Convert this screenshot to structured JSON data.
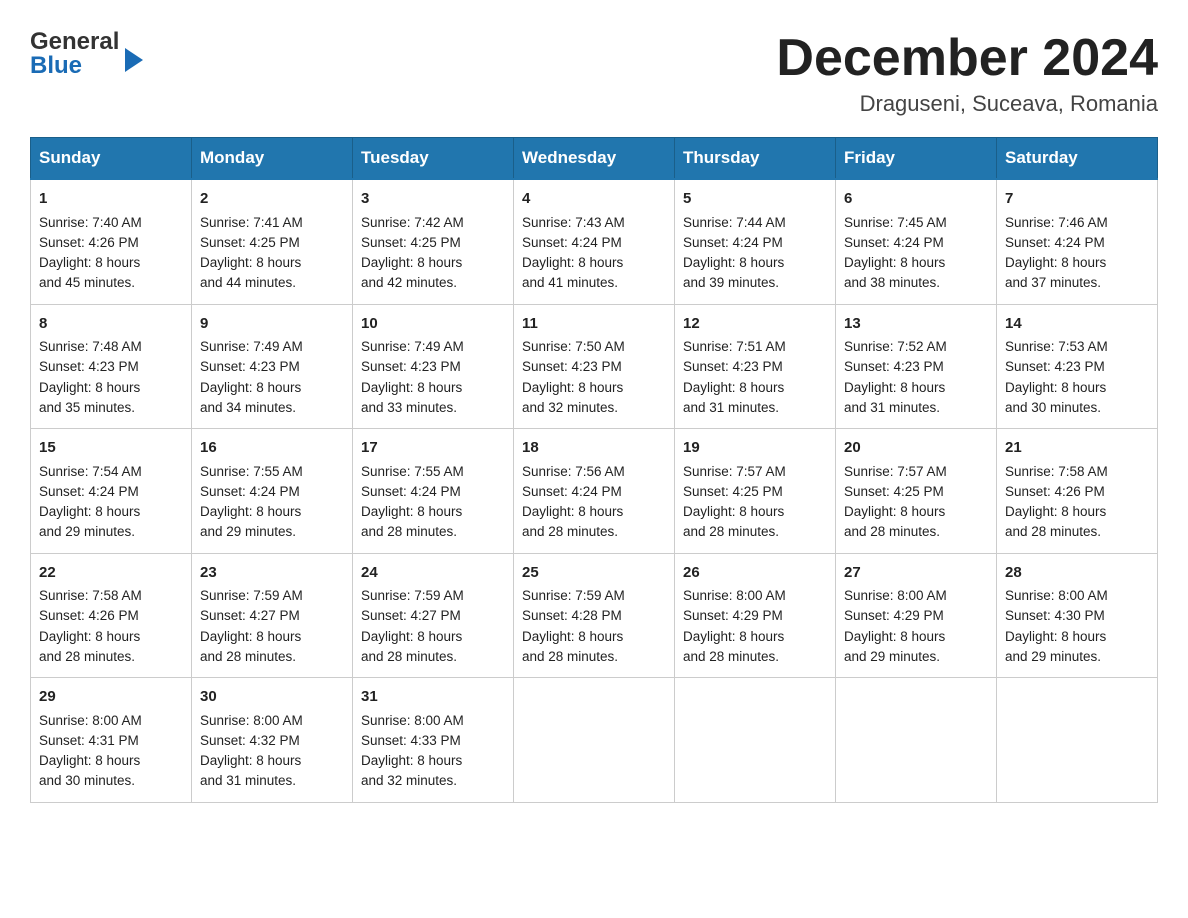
{
  "header": {
    "logo_general": "General",
    "logo_blue": "Blue",
    "month_title": "December 2024",
    "location": "Draguseni, Suceava, Romania"
  },
  "days_of_week": [
    "Sunday",
    "Monday",
    "Tuesday",
    "Wednesday",
    "Thursday",
    "Friday",
    "Saturday"
  ],
  "weeks": [
    [
      {
        "day": "1",
        "sunrise": "Sunrise: 7:40 AM",
        "sunset": "Sunset: 4:26 PM",
        "daylight": "Daylight: 8 hours",
        "daylight2": "and 45 minutes."
      },
      {
        "day": "2",
        "sunrise": "Sunrise: 7:41 AM",
        "sunset": "Sunset: 4:25 PM",
        "daylight": "Daylight: 8 hours",
        "daylight2": "and 44 minutes."
      },
      {
        "day": "3",
        "sunrise": "Sunrise: 7:42 AM",
        "sunset": "Sunset: 4:25 PM",
        "daylight": "Daylight: 8 hours",
        "daylight2": "and 42 minutes."
      },
      {
        "day": "4",
        "sunrise": "Sunrise: 7:43 AM",
        "sunset": "Sunset: 4:24 PM",
        "daylight": "Daylight: 8 hours",
        "daylight2": "and 41 minutes."
      },
      {
        "day": "5",
        "sunrise": "Sunrise: 7:44 AM",
        "sunset": "Sunset: 4:24 PM",
        "daylight": "Daylight: 8 hours",
        "daylight2": "and 39 minutes."
      },
      {
        "day": "6",
        "sunrise": "Sunrise: 7:45 AM",
        "sunset": "Sunset: 4:24 PM",
        "daylight": "Daylight: 8 hours",
        "daylight2": "and 38 minutes."
      },
      {
        "day": "7",
        "sunrise": "Sunrise: 7:46 AM",
        "sunset": "Sunset: 4:24 PM",
        "daylight": "Daylight: 8 hours",
        "daylight2": "and 37 minutes."
      }
    ],
    [
      {
        "day": "8",
        "sunrise": "Sunrise: 7:48 AM",
        "sunset": "Sunset: 4:23 PM",
        "daylight": "Daylight: 8 hours",
        "daylight2": "and 35 minutes."
      },
      {
        "day": "9",
        "sunrise": "Sunrise: 7:49 AM",
        "sunset": "Sunset: 4:23 PM",
        "daylight": "Daylight: 8 hours",
        "daylight2": "and 34 minutes."
      },
      {
        "day": "10",
        "sunrise": "Sunrise: 7:49 AM",
        "sunset": "Sunset: 4:23 PM",
        "daylight": "Daylight: 8 hours",
        "daylight2": "and 33 minutes."
      },
      {
        "day": "11",
        "sunrise": "Sunrise: 7:50 AM",
        "sunset": "Sunset: 4:23 PM",
        "daylight": "Daylight: 8 hours",
        "daylight2": "and 32 minutes."
      },
      {
        "day": "12",
        "sunrise": "Sunrise: 7:51 AM",
        "sunset": "Sunset: 4:23 PM",
        "daylight": "Daylight: 8 hours",
        "daylight2": "and 31 minutes."
      },
      {
        "day": "13",
        "sunrise": "Sunrise: 7:52 AM",
        "sunset": "Sunset: 4:23 PM",
        "daylight": "Daylight: 8 hours",
        "daylight2": "and 31 minutes."
      },
      {
        "day": "14",
        "sunrise": "Sunrise: 7:53 AM",
        "sunset": "Sunset: 4:23 PM",
        "daylight": "Daylight: 8 hours",
        "daylight2": "and 30 minutes."
      }
    ],
    [
      {
        "day": "15",
        "sunrise": "Sunrise: 7:54 AM",
        "sunset": "Sunset: 4:24 PM",
        "daylight": "Daylight: 8 hours",
        "daylight2": "and 29 minutes."
      },
      {
        "day": "16",
        "sunrise": "Sunrise: 7:55 AM",
        "sunset": "Sunset: 4:24 PM",
        "daylight": "Daylight: 8 hours",
        "daylight2": "and 29 minutes."
      },
      {
        "day": "17",
        "sunrise": "Sunrise: 7:55 AM",
        "sunset": "Sunset: 4:24 PM",
        "daylight": "Daylight: 8 hours",
        "daylight2": "and 28 minutes."
      },
      {
        "day": "18",
        "sunrise": "Sunrise: 7:56 AM",
        "sunset": "Sunset: 4:24 PM",
        "daylight": "Daylight: 8 hours",
        "daylight2": "and 28 minutes."
      },
      {
        "day": "19",
        "sunrise": "Sunrise: 7:57 AM",
        "sunset": "Sunset: 4:25 PM",
        "daylight": "Daylight: 8 hours",
        "daylight2": "and 28 minutes."
      },
      {
        "day": "20",
        "sunrise": "Sunrise: 7:57 AM",
        "sunset": "Sunset: 4:25 PM",
        "daylight": "Daylight: 8 hours",
        "daylight2": "and 28 minutes."
      },
      {
        "day": "21",
        "sunrise": "Sunrise: 7:58 AM",
        "sunset": "Sunset: 4:26 PM",
        "daylight": "Daylight: 8 hours",
        "daylight2": "and 28 minutes."
      }
    ],
    [
      {
        "day": "22",
        "sunrise": "Sunrise: 7:58 AM",
        "sunset": "Sunset: 4:26 PM",
        "daylight": "Daylight: 8 hours",
        "daylight2": "and 28 minutes."
      },
      {
        "day": "23",
        "sunrise": "Sunrise: 7:59 AM",
        "sunset": "Sunset: 4:27 PM",
        "daylight": "Daylight: 8 hours",
        "daylight2": "and 28 minutes."
      },
      {
        "day": "24",
        "sunrise": "Sunrise: 7:59 AM",
        "sunset": "Sunset: 4:27 PM",
        "daylight": "Daylight: 8 hours",
        "daylight2": "and 28 minutes."
      },
      {
        "day": "25",
        "sunrise": "Sunrise: 7:59 AM",
        "sunset": "Sunset: 4:28 PM",
        "daylight": "Daylight: 8 hours",
        "daylight2": "and 28 minutes."
      },
      {
        "day": "26",
        "sunrise": "Sunrise: 8:00 AM",
        "sunset": "Sunset: 4:29 PM",
        "daylight": "Daylight: 8 hours",
        "daylight2": "and 28 minutes."
      },
      {
        "day": "27",
        "sunrise": "Sunrise: 8:00 AM",
        "sunset": "Sunset: 4:29 PM",
        "daylight": "Daylight: 8 hours",
        "daylight2": "and 29 minutes."
      },
      {
        "day": "28",
        "sunrise": "Sunrise: 8:00 AM",
        "sunset": "Sunset: 4:30 PM",
        "daylight": "Daylight: 8 hours",
        "daylight2": "and 29 minutes."
      }
    ],
    [
      {
        "day": "29",
        "sunrise": "Sunrise: 8:00 AM",
        "sunset": "Sunset: 4:31 PM",
        "daylight": "Daylight: 8 hours",
        "daylight2": "and 30 minutes."
      },
      {
        "day": "30",
        "sunrise": "Sunrise: 8:00 AM",
        "sunset": "Sunset: 4:32 PM",
        "daylight": "Daylight: 8 hours",
        "daylight2": "and 31 minutes."
      },
      {
        "day": "31",
        "sunrise": "Sunrise: 8:00 AM",
        "sunset": "Sunset: 4:33 PM",
        "daylight": "Daylight: 8 hours",
        "daylight2": "and 32 minutes."
      },
      null,
      null,
      null,
      null
    ]
  ]
}
